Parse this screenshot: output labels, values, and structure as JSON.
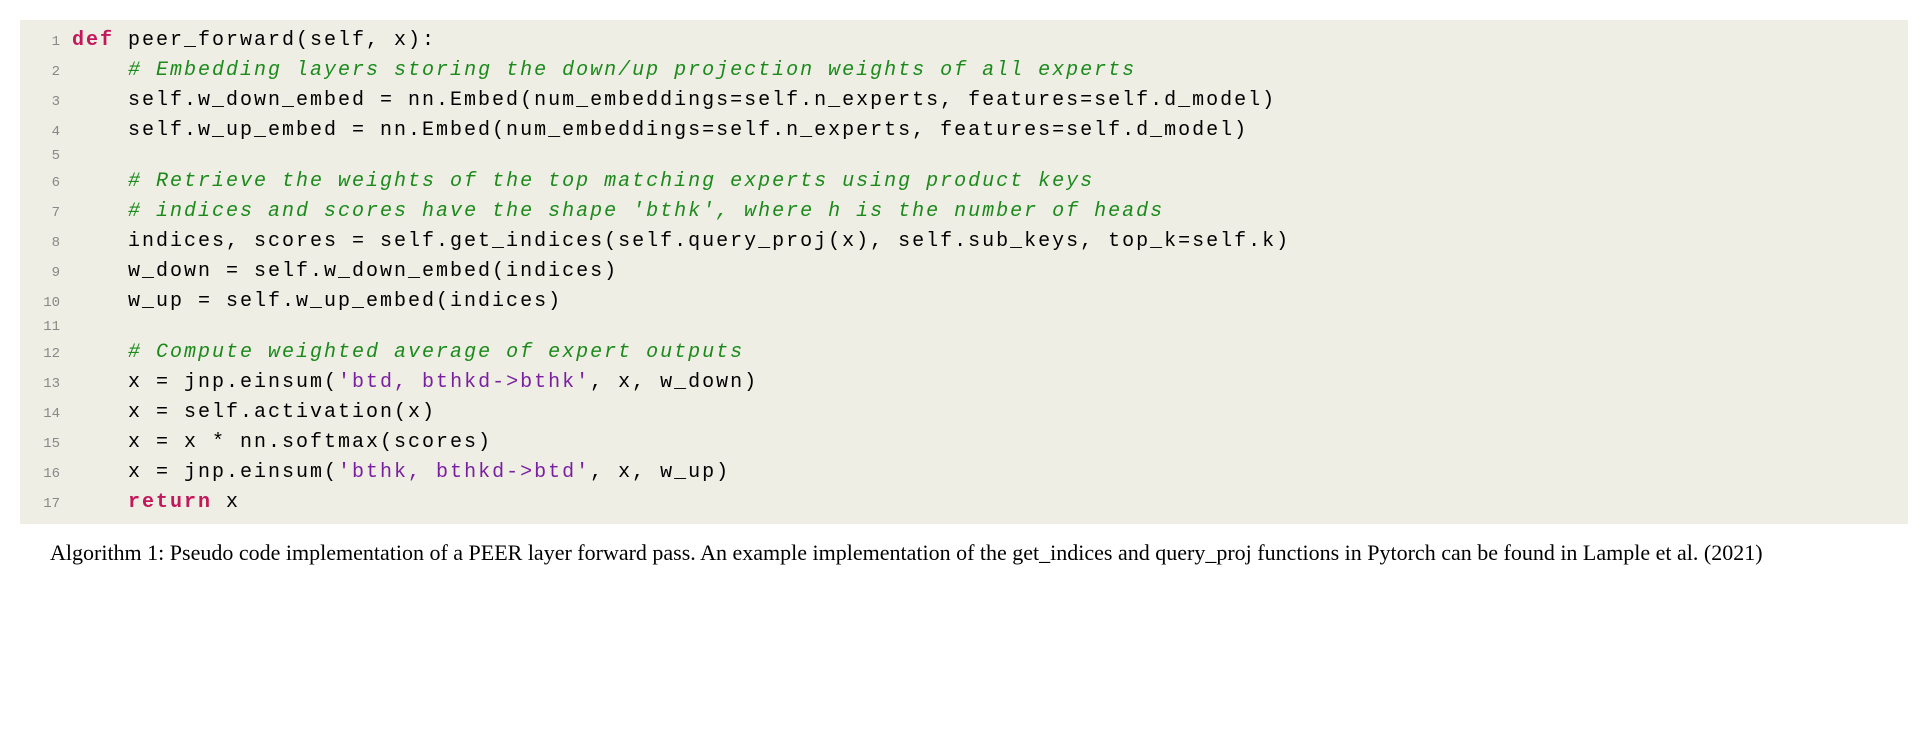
{
  "code": {
    "lines": [
      {
        "n": "1",
        "segments": [
          {
            "t": "def ",
            "c": "kw"
          },
          {
            "t": "peer_forward(self, x):",
            "c": ""
          }
        ]
      },
      {
        "n": "2",
        "segments": [
          {
            "t": "    ",
            "c": ""
          },
          {
            "t": "# Embedding layers storing the down/up projection weights of all experts",
            "c": "comment"
          }
        ]
      },
      {
        "n": "3",
        "segments": [
          {
            "t": "    self.w_down_embed = nn.Embed(num_embeddings=self.n_experts, features=self.d_model)",
            "c": ""
          }
        ]
      },
      {
        "n": "4",
        "segments": [
          {
            "t": "    self.w_up_embed = nn.Embed(num_embeddings=self.n_experts, features=self.d_model)",
            "c": ""
          }
        ]
      },
      {
        "n": "5",
        "segments": [
          {
            "t": "",
            "c": ""
          }
        ]
      },
      {
        "n": "6",
        "segments": [
          {
            "t": "    ",
            "c": ""
          },
          {
            "t": "# Retrieve the weights of the top matching experts using product keys",
            "c": "comment"
          }
        ]
      },
      {
        "n": "7",
        "segments": [
          {
            "t": "    ",
            "c": ""
          },
          {
            "t": "# indices and scores have the shape 'bthk', where h is the number of heads",
            "c": "comment"
          }
        ]
      },
      {
        "n": "8",
        "segments": [
          {
            "t": "    indices, scores = self.get_indices(self.query_proj(x), self.sub_keys, top_k=self.k)",
            "c": ""
          }
        ]
      },
      {
        "n": "9",
        "segments": [
          {
            "t": "    w_down = self.w_down_embed(indices)",
            "c": ""
          }
        ]
      },
      {
        "n": "10",
        "segments": [
          {
            "t": "    w_up = self.w_up_embed(indices)",
            "c": ""
          }
        ]
      },
      {
        "n": "11",
        "segments": [
          {
            "t": "",
            "c": ""
          }
        ]
      },
      {
        "n": "12",
        "segments": [
          {
            "t": "    ",
            "c": ""
          },
          {
            "t": "# Compute weighted average of expert outputs",
            "c": "comment"
          }
        ]
      },
      {
        "n": "13",
        "segments": [
          {
            "t": "    x = jnp.einsum(",
            "c": ""
          },
          {
            "t": "'btd, bthkd->bthk'",
            "c": "str"
          },
          {
            "t": ", x, w_down)",
            "c": ""
          }
        ]
      },
      {
        "n": "14",
        "segments": [
          {
            "t": "    x = self.activation(x)",
            "c": ""
          }
        ]
      },
      {
        "n": "15",
        "segments": [
          {
            "t": "    x = x * nn.softmax(scores)",
            "c": ""
          }
        ]
      },
      {
        "n": "16",
        "segments": [
          {
            "t": "    x = jnp.einsum(",
            "c": ""
          },
          {
            "t": "'bthk, bthkd->btd'",
            "c": "str"
          },
          {
            "t": ", x, w_up)",
            "c": ""
          }
        ]
      },
      {
        "n": "17",
        "segments": [
          {
            "t": "    ",
            "c": ""
          },
          {
            "t": "return ",
            "c": "kw"
          },
          {
            "t": "x",
            "c": ""
          }
        ]
      }
    ]
  },
  "caption": "Algorithm 1: Pseudo code implementation of a PEER layer forward pass. An example implementation of the get_indices and query_proj functions in Pytorch can be found in Lample et al. (2021)"
}
